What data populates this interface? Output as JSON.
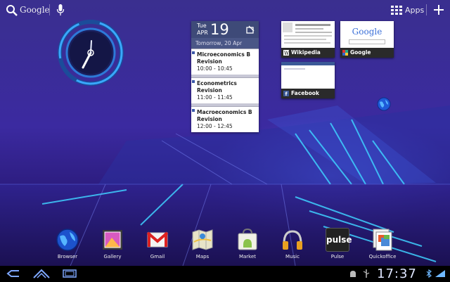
{
  "search": {
    "label": "Google"
  },
  "apps": {
    "label": "Apps"
  },
  "calendar": {
    "weekday": "Tue",
    "month": "APR",
    "day": "19",
    "subheader": "Tomorrow, 20 Apr",
    "events": [
      {
        "title": "Microeconomics B Revision",
        "time": "10:00 - 10:45"
      },
      {
        "title": "Econometrics Revision",
        "time": "11:00 - 11:45"
      },
      {
        "title": "Macroeconomics B Revision",
        "time": "12:00 - 12:45"
      }
    ]
  },
  "bookmarks": [
    {
      "label": "Wikipedia",
      "icon": "wikipedia-icon"
    },
    {
      "label": "Google",
      "icon": "google-icon",
      "thumb_text": "Google"
    },
    {
      "label": "Facebook",
      "icon": "facebook-icon"
    }
  ],
  "dock": [
    {
      "label": "Browser",
      "icon": "browser-globe-icon"
    },
    {
      "label": "Gallery",
      "icon": "gallery-icon"
    },
    {
      "label": "Gmail",
      "icon": "gmail-icon"
    },
    {
      "label": "Maps",
      "icon": "maps-icon"
    },
    {
      "label": "Market",
      "icon": "market-bag-icon"
    },
    {
      "label": "Music",
      "icon": "music-headphones-icon"
    },
    {
      "label": "Pulse",
      "icon": "pulse-icon",
      "icon_text": "pulse"
    },
    {
      "label": "Quickoffice",
      "icon": "quickoffice-icon"
    }
  ],
  "status": {
    "time": "17:37"
  },
  "colors": {
    "accent": "#33b5e5",
    "calendar_header": "#3e4a78",
    "background": "#3b2aa0"
  }
}
